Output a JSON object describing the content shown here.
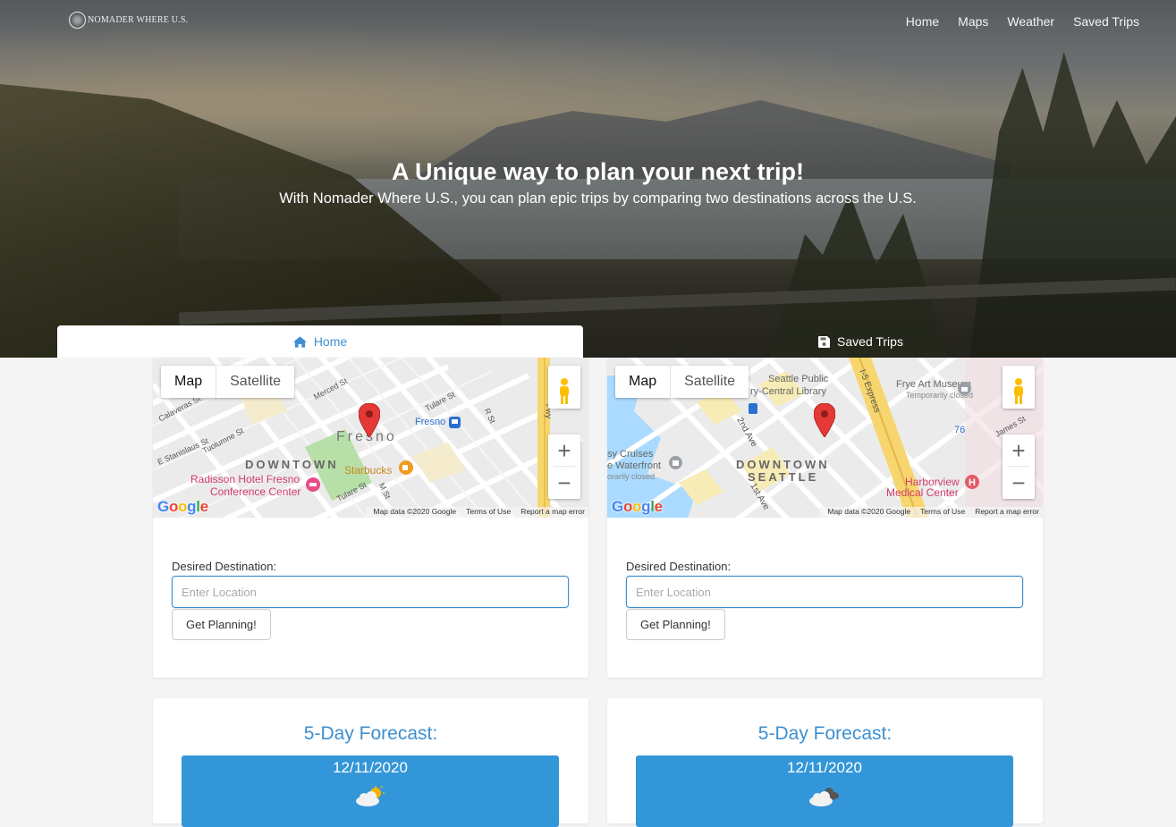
{
  "navbar": {
    "brand": "NOMADER WHERE U.S.",
    "links": [
      "Home",
      "Maps",
      "Weather",
      "Saved Trips"
    ]
  },
  "hero": {
    "title": "A Unique way to plan your next trip!",
    "subtitle": "With Nomader Where U.S., you can plan epic trips by comparing two destinations across the U.S."
  },
  "tabs": {
    "home": "Home",
    "saved": "Saved Trips"
  },
  "map_common": {
    "map_button": "Map",
    "satellite_button": "Satellite",
    "zoom_in": "+",
    "zoom_out": "−",
    "google": [
      "G",
      "o",
      "o",
      "g",
      "l",
      "e"
    ],
    "map_data": "Map data ©2020 Google",
    "terms": "Terms of Use",
    "report": "Report a map error"
  },
  "left": {
    "map_labels": {
      "city": "Fresno",
      "downtown": "DOWNTOWN",
      "starbucks": "Starbucks",
      "radisson_1": "Radisson Hotel Fresno",
      "radisson_2": "Conference Center",
      "fresno_station": "Fresno",
      "stanislaus": "E Stanislaus St",
      "tuolumne": "Tuolumne St",
      "tulare": "Tulare St",
      "tulare2": "Tulare St",
      "m_st": "M St",
      "r_st": "R St",
      "merced": "Merced St",
      "calaveras": "Calaveras St",
      "fwy": "Fwy"
    },
    "destination_label": "Desired Destination:",
    "destination_placeholder": "Enter Location",
    "button": "Get Planning!",
    "forecast_title": "5-Day Forecast:",
    "forecast_date": "12/11/2020",
    "forecast_icon": "partly-sunny-icon"
  },
  "right": {
    "map_labels": {
      "downtown": "DOWNTOWN",
      "seattle": "SEATTLE",
      "library_1": "Seattle Public",
      "library_2": "ry-Central Library",
      "frye_1": "Frye Art Museum",
      "frye_2": "Temporarily closed",
      "cruises_1": "sy Cruises",
      "cruises_2": "e Waterfront",
      "cruises_3": "orarily closed",
      "harborview_1": "Harborview",
      "harborview_2": "Medical Center",
      "i5": "I-5 Express",
      "second_ave": "2nd Ave",
      "first_ave": "1st Ave",
      "james": "James St",
      "route": "76"
    },
    "destination_label": "Desired Destination:",
    "destination_placeholder": "Enter Location",
    "button": "Get Planning!",
    "forecast_title": "5-Day Forecast:",
    "forecast_date": "12/11/2020",
    "forecast_icon": "cloudy-icon"
  },
  "colors": {
    "accent": "#3d8fd1",
    "forecast_bg": "#3396d8",
    "pin": "#e53935"
  }
}
